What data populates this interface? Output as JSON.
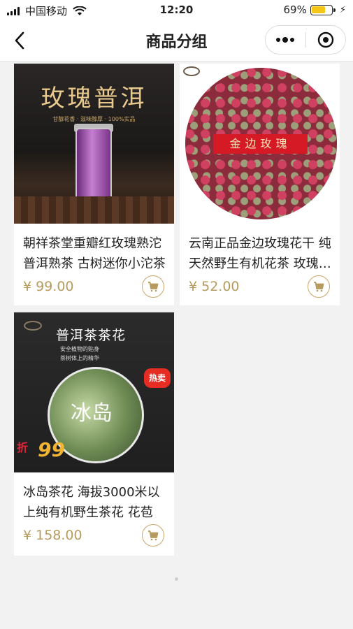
{
  "status_bar": {
    "carrier": "中国移动",
    "time": "12:20",
    "battery": "69%",
    "battery_level": 0.69
  },
  "nav": {
    "title": "商品分组"
  },
  "products": [
    {
      "image_text": "玫瑰普洱",
      "image_sub": "甘醇花香 · 滋味醇厚 · 100%实品",
      "name": "朝祥茶堂重瓣红玫瑰熟沱 普洱熟茶 古树迷你小沱茶",
      "price": "¥ 99.00"
    },
    {
      "image_text": "金边玫瑰",
      "name": "云南正品金边玫瑰花干 纯天然野生有机花茶 玫瑰花冠",
      "price": "¥ 52.00"
    },
    {
      "image_text": "普洱茶茶花",
      "image_lines": [
        "安全植物的贴身",
        "茶树体上的精华"
      ],
      "image_center": "冰岛",
      "image_badge": "热卖",
      "image_discount_label": "折",
      "image_discount_value": "99",
      "name": "冰岛茶花  海拔3000米以上纯有机野生茶花 花苞",
      "price": "¥ 158.00"
    }
  ],
  "colors": {
    "price": "#b79b5e",
    "cart_border": "#c9a768",
    "background": "#f2f2f2"
  }
}
